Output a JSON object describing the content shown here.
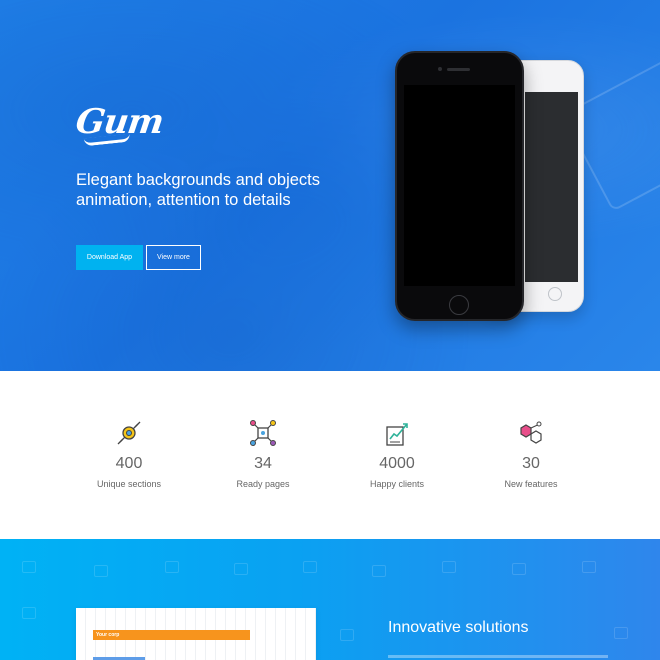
{
  "hero": {
    "logo_text": "Gum",
    "tagline": "Elegant backgrounds and objects animation, attention to details",
    "primary_button": "Download App",
    "secondary_button": "View more",
    "accent_color": "#00b2f0",
    "background_color": "#1b73e0"
  },
  "stats": [
    {
      "icon": "flight-icon",
      "value": "400",
      "label": "Unique sections"
    },
    {
      "icon": "network-icon",
      "value": "34",
      "label": "Ready pages"
    },
    {
      "icon": "growth-chart-icon",
      "value": "4000",
      "label": "Happy clients"
    },
    {
      "icon": "hexagons-icon",
      "value": "30",
      "label": "New features"
    }
  ],
  "features": {
    "title": "Innovative solutions",
    "screenshot_bar_label": "Your corp",
    "bar_color": "#f7941d"
  }
}
